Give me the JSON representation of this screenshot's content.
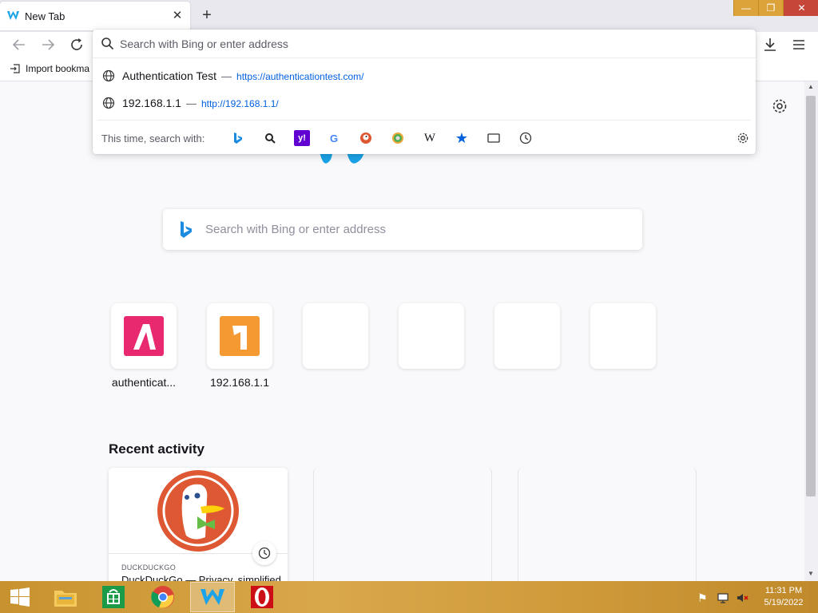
{
  "browser": {
    "tab_title": "New Tab",
    "tab_close": "✕",
    "new_tab": "+",
    "bookmarks_item": "Import bookma"
  },
  "window_controls": {
    "minimize": "—",
    "maximize": "❐",
    "close": "✕"
  },
  "urlbar": {
    "placeholder": "Search with Bing or enter address",
    "suggestions": [
      {
        "title": "Authentication Test",
        "url": "https://authenticationtest.com/"
      },
      {
        "title": "192.168.1.1",
        "url": "http://192.168.1.1/"
      }
    ],
    "one_off_label": "This time, search with:",
    "engines": [
      "bing",
      "ebay-search",
      "yahoo",
      "google",
      "duckduckgo",
      "startpage",
      "wikipedia",
      "bookmarks",
      "tabs",
      "history"
    ],
    "dash": "—"
  },
  "newtab": {
    "search_placeholder": "Search with Bing or enter address",
    "shortcuts": [
      {
        "label": "authenticat...",
        "icon": "authentication-tile-icon",
        "color": "#e8296f"
      },
      {
        "label": "192.168.1.1",
        "icon": "number-one-tile-icon",
        "color": "#f59a33"
      },
      {
        "label": ""
      },
      {
        "label": ""
      },
      {
        "label": ""
      },
      {
        "label": ""
      }
    ],
    "recent_activity_title": "Recent activity",
    "recent_card": {
      "source": "DUCKDUCKGO",
      "text": "DuckDuckGo — Privacy, simplified."
    }
  },
  "taskbar": {
    "items": [
      "start-button",
      "file-explorer",
      "store",
      "chrome",
      "waterfox",
      "opera"
    ],
    "clock_time": "11:31 PM",
    "clock_date": "5/19/2022"
  },
  "colors": {
    "accent": "#0060df",
    "taskbar": "#d9a84b",
    "close": "#c7463a"
  }
}
